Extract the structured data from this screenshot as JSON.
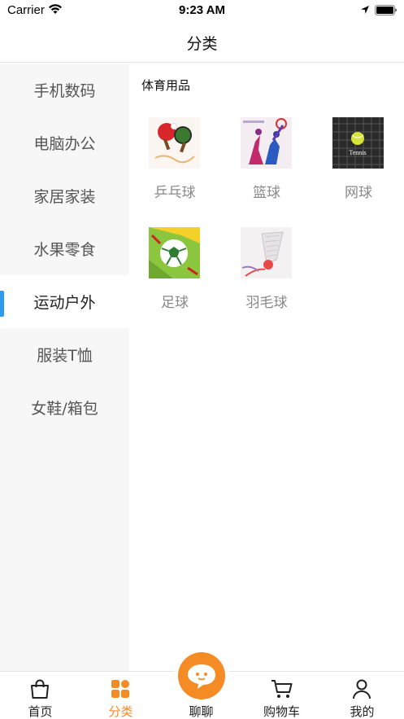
{
  "status_bar": {
    "carrier": "Carrier",
    "time": "9:23 AM"
  },
  "nav": {
    "title": "分类"
  },
  "sidebar": {
    "items": [
      {
        "label": "手机数码",
        "active": false
      },
      {
        "label": "电脑办公",
        "active": false
      },
      {
        "label": "家居家装",
        "active": false
      },
      {
        "label": "水果零食",
        "active": false
      },
      {
        "label": "运动户外",
        "active": true
      },
      {
        "label": "服装T恤",
        "active": false
      },
      {
        "label": "女鞋/箱包",
        "active": false
      }
    ]
  },
  "content": {
    "section_title": "体育用品",
    "items": [
      {
        "label": "乒乓球",
        "icon": "ping-pong-image"
      },
      {
        "label": "篮球",
        "icon": "basketball-image"
      },
      {
        "label": "网球",
        "icon": "tennis-image",
        "image_text": "Tennis"
      },
      {
        "label": "足球",
        "icon": "football-image"
      },
      {
        "label": "羽毛球",
        "icon": "badminton-image"
      }
    ]
  },
  "tabbar": {
    "tabs": [
      {
        "label": "首页",
        "icon": "shopping-bag-icon",
        "active": false
      },
      {
        "label": "分类",
        "icon": "category-grid-icon",
        "active": true
      },
      {
        "label": "聊聊",
        "icon": "chat-bubble-icon",
        "active": false
      },
      {
        "label": "购物车",
        "icon": "cart-icon",
        "active": false
      },
      {
        "label": "我的",
        "icon": "user-icon",
        "active": false
      }
    ]
  },
  "colors": {
    "accent": "#f48b24",
    "indicator": "#2f9bea",
    "sidebar_bg": "#f7f7f7"
  }
}
